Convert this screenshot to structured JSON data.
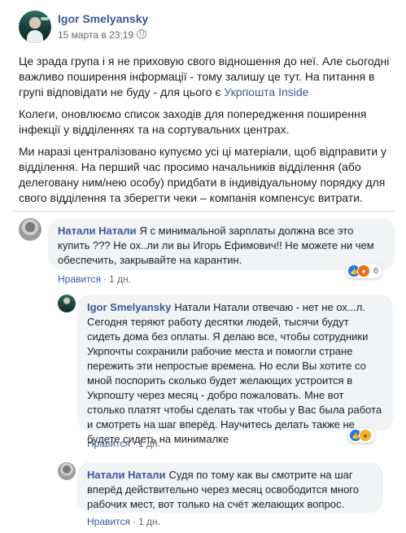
{
  "post": {
    "author": "Igor Smelyansky",
    "timestamp": "15 марта в 23:19",
    "paragraph1_text": "Це зрада група і я не приховую свого відношення до неї. Але сьогодні важливо поширення інформації - тому залишу це тут. На питання в групі відповідати не буду - для цього є ",
    "paragraph1_link": "Укрпошта Inside",
    "paragraph2": "Колеги, оновлюємо список заходів для попередження поширення інфекції у відділеннях та на сортувальних центрах.",
    "paragraph3": "Ми наразі централізовано купуємо усі ці матеріали, щоб відправити у відділення. На перший час просимо начальників відділення (або делеговану ним/нею особу) придбати в індивідуальному порядку для свого відділення та зберегти чеки – компанія компенсує витрати."
  },
  "comments": [
    {
      "author": "Натали Натали",
      "text": "Я с минимальной зарплаты должна все это купить ??? Не ох..ли ли вы Игорь Ефимович!! Не можете ни чем обеспечить, закрывайте на карантин.",
      "like_label": "Нравится",
      "time": "1 дн.",
      "reaction_count": "6",
      "reaction_icons": [
        "like-icon",
        "angry-icon"
      ]
    },
    {
      "author": "Igor Smelyansky",
      "text": "Натали Натали отвечаю - нет не ох...л. Сегодня теряют работу десятки людей, тысячи будут сидеть дома без оплаты. Я делаю все, чтобы сотрудники Укрпочты сохранили рабочие места и помогли стране пережить эти непростые времена. Но если Вы хотите со мной поспорить сколько будет желающих устроится в Укрпошту через месяц - добро пожаловать. Мне вот столько платят чтобы сделать так чтобы у Вас была работа и смотреть на шаг вперёд. Научитесь делать также не будете сидеть на минималке",
      "like_label": "Нравится",
      "time": "1 дн.",
      "reaction_count": "",
      "reaction_icons": [
        "like-icon",
        "sad-icon"
      ]
    },
    {
      "author": "Натали Натали",
      "text": "Судя по тому как вы смотрите на шаг вперёд действительно через месяц освободится много рабочих мест, вот только на счёт желающих вопрос.",
      "like_label": "Нравится",
      "time": "1 дн."
    }
  ],
  "colors": {
    "link": "#385898",
    "bubble": "#f2f3f5",
    "meta": "#606770"
  }
}
